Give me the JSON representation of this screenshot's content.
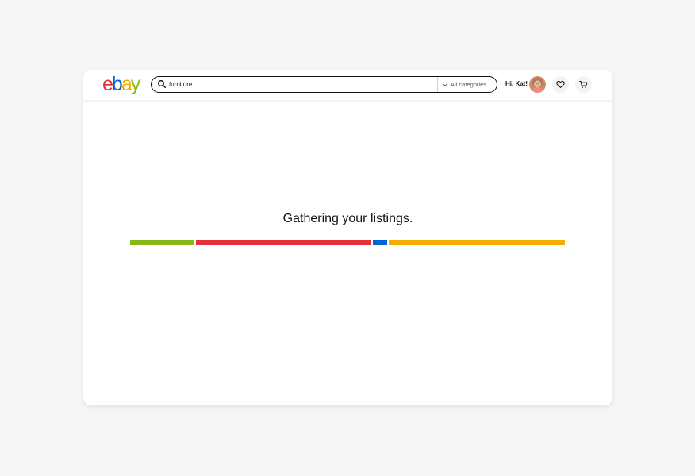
{
  "header": {
    "logo": {
      "letters": [
        {
          "char": "e",
          "color": "#e53238"
        },
        {
          "char": "b",
          "color": "#0064d2"
        },
        {
          "char": "a",
          "color": "#f5af02"
        },
        {
          "char": "y",
          "color": "#86b817"
        }
      ]
    },
    "search": {
      "value": "furniture",
      "icon": "search-icon",
      "category_selected": "All categories",
      "category_icon": "chevron-down-icon"
    },
    "user": {
      "greeting": "Hi, Kat!"
    },
    "icons": {
      "watchlist": "heart-icon",
      "cart": "cart-icon"
    }
  },
  "main": {
    "loading_text": "Gathering your listings.",
    "progress_segments": [
      {
        "color": "#86b817"
      },
      {
        "color": "#e53238"
      },
      {
        "color": "#0064d2"
      },
      {
        "color": "#f5af02"
      }
    ]
  }
}
